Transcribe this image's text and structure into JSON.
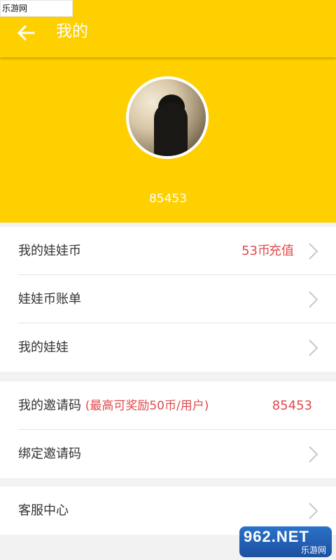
{
  "watermark": {
    "text": "乐游网 www.962.net"
  },
  "titlebar": {
    "title": "我的",
    "back_icon": "arrow-left-icon"
  },
  "profile": {
    "user_id": "85453"
  },
  "colors": {
    "brand_yellow": "#ffd000",
    "accent_red": "#e0494d",
    "text_dark": "#333333"
  },
  "groups": [
    {
      "rows": [
        {
          "label": "我的娃娃币",
          "value": "53币",
          "action": "充值"
        },
        {
          "label": "娃娃币账单"
        },
        {
          "label": "我的娃娃"
        }
      ]
    },
    {
      "rows": [
        {
          "label": "我的邀请码",
          "hint": "(最高可奖励50币/用户)",
          "value": "85453"
        },
        {
          "label": "绑定邀请码"
        }
      ]
    },
    {
      "rows": [
        {
          "label": "客服中心"
        }
      ]
    }
  ],
  "logo": {
    "main": "962.NET",
    "sub": "乐游网"
  }
}
